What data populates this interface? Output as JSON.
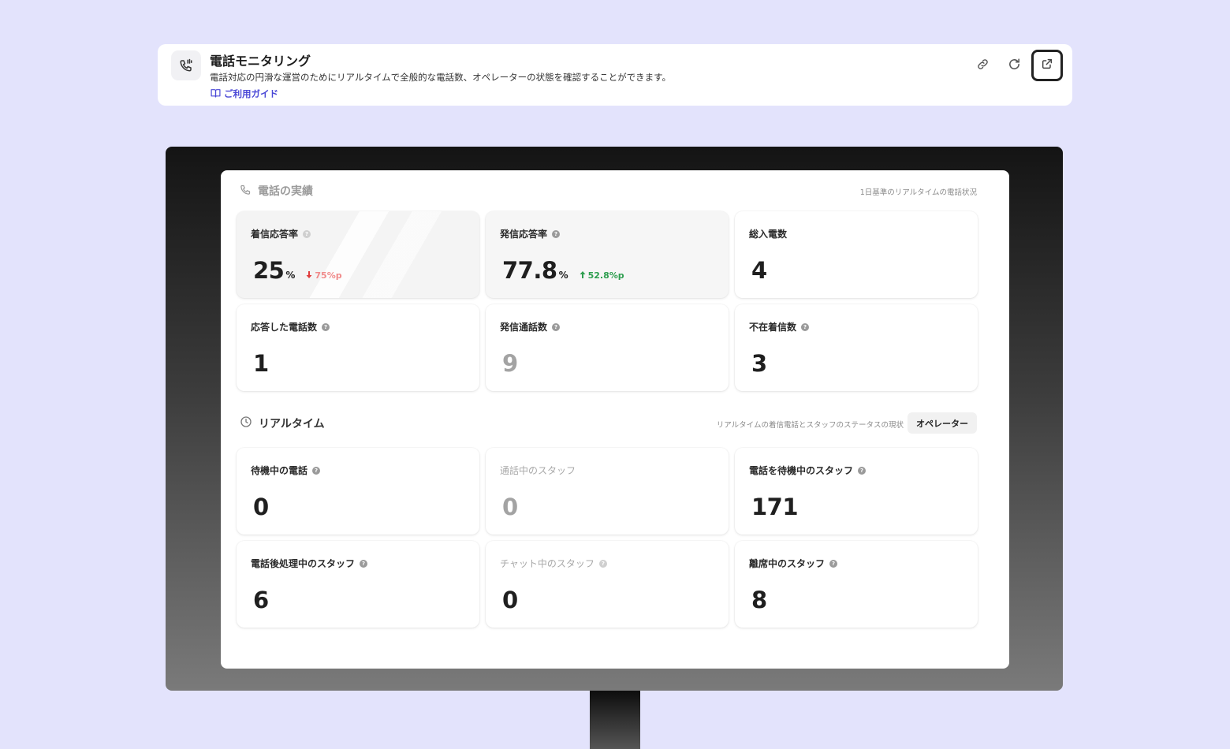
{
  "header": {
    "title": "電話モニタリング",
    "description": "電話対応の円滑な運営のためにリアルタイムで全般的な電話数、オペレーターの状態を確認することができます。",
    "guide_label": "ご利用ガイド",
    "icons": [
      "phone-monitor-icon",
      "link-icon",
      "refresh-icon",
      "external-link-icon"
    ]
  },
  "performance": {
    "title": "電話の実績",
    "note": "1日基準のリアルタイムの電話状況",
    "cards": [
      {
        "label": "着信応答率",
        "value": "25",
        "unit": "%",
        "delta": "75%p",
        "delta_dir": "down"
      },
      {
        "label": "発信応答率",
        "value": "77.8",
        "unit": "%",
        "delta": "52.8%p",
        "delta_dir": "up"
      },
      {
        "label": "総入電数",
        "value": "4"
      },
      {
        "label": "応答した電話数",
        "value": "1"
      },
      {
        "label": "発信通話数",
        "value": "9"
      },
      {
        "label": "不在着信数",
        "value": "3"
      }
    ]
  },
  "realtime": {
    "title": "リアルタイム",
    "note": "リアルタイムの着信電話とスタッフのステータスの現状",
    "operator_button": "オペレーター",
    "cards": [
      {
        "label": "待機中の電話",
        "value": "0"
      },
      {
        "label": "通話中のスタッフ",
        "value": "0"
      },
      {
        "label": "電話を待機中のスタッフ",
        "value": "171"
      },
      {
        "label": "電話後処理中のスタッフ",
        "value": "6"
      },
      {
        "label": "チャット中のスタッフ",
        "value": "0"
      },
      {
        "label": "離席中のスタッフ",
        "value": "8"
      }
    ]
  },
  "colors": {
    "background": "#e3e3fc",
    "accent": "#4a48d6",
    "delta_down": "#f08a8a",
    "delta_up": "#2e9e4f"
  }
}
